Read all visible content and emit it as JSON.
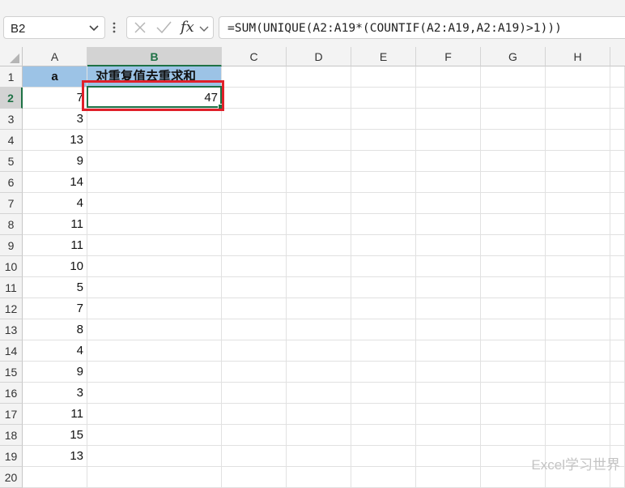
{
  "formula_bar": {
    "name_box": "B2",
    "fx_label": "fx",
    "formula": "=SUM(UNIQUE(A2:A19*(COUNTIF(A2:A19,A2:A19)>1)))"
  },
  "columns": [
    "A",
    "B",
    "C",
    "D",
    "E",
    "F",
    "G",
    "H"
  ],
  "rows": [
    "1",
    "2",
    "3",
    "4",
    "5",
    "6",
    "7",
    "8",
    "9",
    "10",
    "11",
    "12",
    "13",
    "14",
    "15",
    "16",
    "17",
    "18",
    "19",
    "20"
  ],
  "cells": {
    "A1": "a",
    "B1": "对重复值去重求和",
    "B2": "47",
    "A_values": [
      "7",
      "3",
      "13",
      "9",
      "14",
      "4",
      "11",
      "11",
      "10",
      "5",
      "7",
      "8",
      "4",
      "9",
      "3",
      "11",
      "15",
      "13"
    ]
  },
  "selection": {
    "active_cell": "B2",
    "active_column": "B",
    "active_row": "2"
  },
  "watermark": "Excel学习世界",
  "colors": {
    "header_fill": "#9cc3e6",
    "selection": "#1e7145",
    "highlight_box": "#e0202a"
  }
}
